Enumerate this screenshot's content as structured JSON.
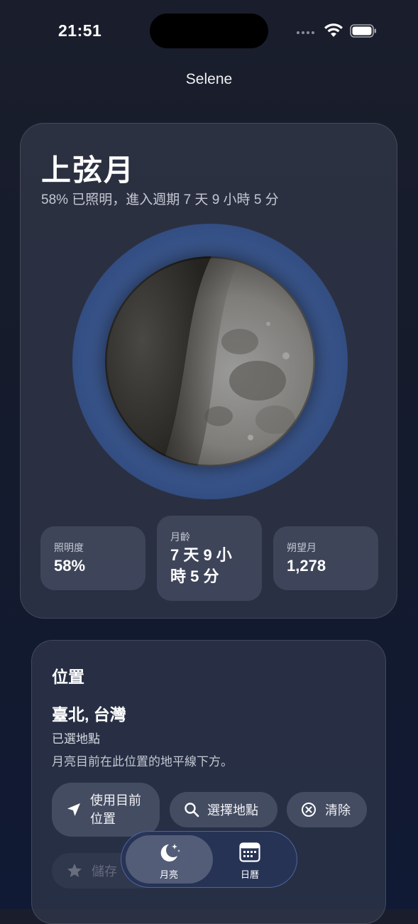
{
  "status_bar": {
    "time": "21:51"
  },
  "app": {
    "title": "Selene"
  },
  "moon_card": {
    "phase_name": "上弦月",
    "subtitle": "58% 已照明，進入週期 7 天 9 小時 5 分",
    "illumination_fraction": 0.58,
    "stats": [
      {
        "label": "照明度",
        "value": "58%"
      },
      {
        "label": "月齡",
        "value_line1": "7 天 9 小",
        "value_line2": "時 5 分"
      },
      {
        "label": "朔望月",
        "value": "1,278"
      }
    ]
  },
  "location_card": {
    "heading": "位置",
    "place": "臺北, 台灣",
    "selected_label": "已選地點",
    "note": "月亮目前在此位置的地平線下方。",
    "buttons": {
      "use_current_line1": "使用目前",
      "use_current_line2": "位置",
      "choose_place": "選擇地點",
      "clear": "清除",
      "save": "儲存"
    }
  },
  "tab_bar": {
    "tabs": [
      {
        "label": "月亮",
        "icon": "moon-stars-icon",
        "active": true
      },
      {
        "label": "日曆",
        "icon": "calendar-icon",
        "active": false
      }
    ]
  },
  "colors": {
    "accent_glow": "#3d5a92",
    "background": "#151b2b"
  }
}
